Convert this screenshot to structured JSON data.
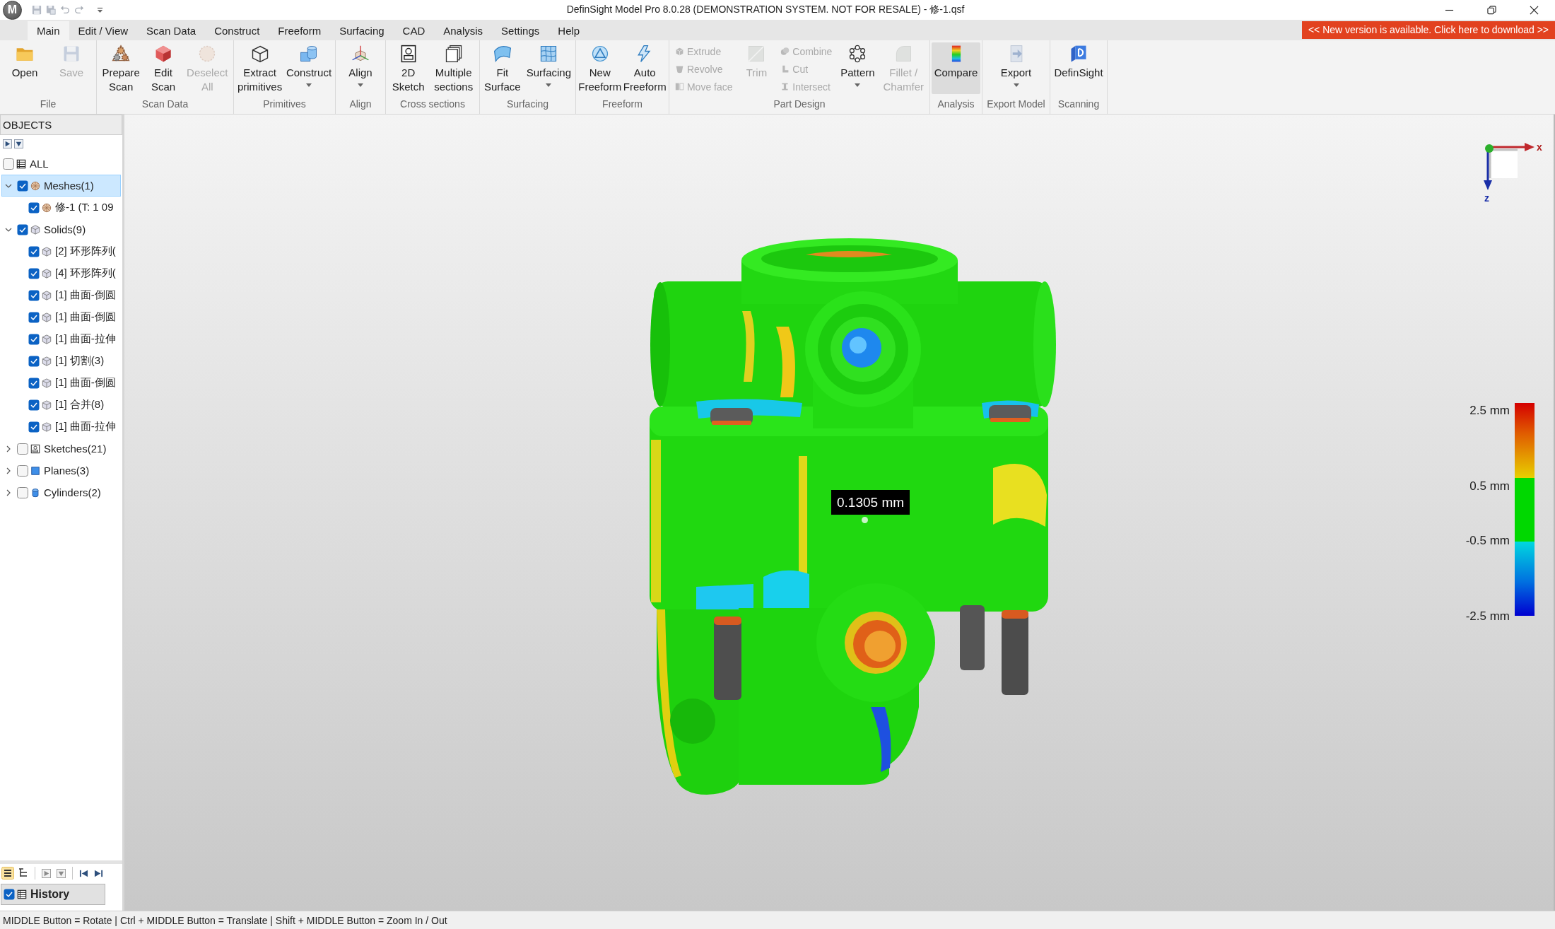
{
  "window": {
    "logo": "M",
    "title": "DefinSight Model Pro 8.0.28 (DEMONSTRATION SYSTEM. NOT FOR RESALE) - 修-1.qsf"
  },
  "menu_tabs": [
    {
      "label": "Main",
      "selected": true
    },
    {
      "label": "Edit / View",
      "selected": false
    },
    {
      "label": "Scan Data",
      "selected": false
    },
    {
      "label": "Construct",
      "selected": false
    },
    {
      "label": "Freeform",
      "selected": false
    },
    {
      "label": "Surfacing",
      "selected": false
    },
    {
      "label": "CAD",
      "selected": false
    },
    {
      "label": "Analysis",
      "selected": false
    },
    {
      "label": "Settings",
      "selected": false
    },
    {
      "label": "Help",
      "selected": false
    }
  ],
  "update_banner": {
    "label": "<< New version is available. Click here to download >>"
  },
  "ribbon": [
    {
      "label": "File",
      "items": [
        {
          "kind": "large",
          "label": "Open",
          "disabled": false,
          "pressed": false
        },
        {
          "kind": "large",
          "label": "Save",
          "disabled": true,
          "pressed": false
        }
      ]
    },
    {
      "label": "Scan Data",
      "items": [
        {
          "kind": "large",
          "label": "Prepare\nScan",
          "disabled": false,
          "pressed": false
        },
        {
          "kind": "large",
          "label": "Edit\nScan",
          "disabled": false,
          "pressed": false
        },
        {
          "kind": "large",
          "label": "Deselect\nAll",
          "disabled": true,
          "pressed": false
        }
      ]
    },
    {
      "label": "Primitives",
      "items": [
        {
          "kind": "large",
          "label": "Extract\nprimitives",
          "disabled": false,
          "pressed": false
        },
        {
          "kind": "large",
          "label": "Construct",
          "disabled": false,
          "pressed": false,
          "dropdown": true
        }
      ]
    },
    {
      "label": "Align",
      "items": [
        {
          "kind": "large",
          "label": "Align",
          "disabled": false,
          "pressed": false,
          "dropdown": true
        }
      ]
    },
    {
      "label": "Cross sections",
      "items": [
        {
          "kind": "large",
          "label": "2D\nSketch",
          "disabled": false,
          "pressed": false
        },
        {
          "kind": "large",
          "label": "Multiple\nsections",
          "disabled": false,
          "pressed": false
        }
      ]
    },
    {
      "label": "Surfacing",
      "items": [
        {
          "kind": "large",
          "label": "Fit\nSurface",
          "disabled": false,
          "pressed": false
        },
        {
          "kind": "large",
          "label": "Surfacing",
          "disabled": false,
          "pressed": false,
          "dropdown": true
        }
      ]
    },
    {
      "label": "Freeform",
      "items": [
        {
          "kind": "large",
          "label": "New\nFreeform",
          "disabled": false,
          "pressed": false
        },
        {
          "kind": "large",
          "label": "Auto\nFreeform",
          "disabled": false,
          "pressed": false
        }
      ]
    },
    {
      "label": "Part Design",
      "items": [
        {
          "kind": "stack",
          "buttons": [
            {
              "label": "Extrude",
              "disabled": true
            },
            {
              "label": "Revolve",
              "disabled": true
            },
            {
              "label": "Move face",
              "disabled": true
            }
          ]
        },
        {
          "kind": "large",
          "label": "Trim",
          "disabled": true,
          "pressed": false
        },
        {
          "kind": "stack",
          "buttons": [
            {
              "label": "Combine",
              "disabled": true
            },
            {
              "label": "Cut",
              "disabled": true
            },
            {
              "label": "Intersect",
              "disabled": true
            }
          ]
        },
        {
          "kind": "large",
          "label": "Pattern",
          "disabled": false,
          "pressed": false,
          "dropdown": true
        },
        {
          "kind": "large",
          "label": "Fillet /\nChamfer",
          "disabled": true,
          "pressed": false
        }
      ]
    },
    {
      "label": "Analysis",
      "items": [
        {
          "kind": "large",
          "label": "Compare",
          "disabled": false,
          "pressed": true
        }
      ]
    },
    {
      "label": "Export Model",
      "items": [
        {
          "kind": "large",
          "label": "Export",
          "disabled": false,
          "pressed": false,
          "dropdown": true
        }
      ]
    },
    {
      "label": "Scanning",
      "items": [
        {
          "kind": "large",
          "label": "DefinSight",
          "disabled": false,
          "pressed": false
        }
      ]
    }
  ],
  "objects_panel": {
    "title": "OBJECTS",
    "all": {
      "label": "ALL",
      "checked": false,
      "selected": false
    },
    "tree": [
      {
        "kind": "mesh",
        "label": "Meshes(1)",
        "expanded": true,
        "checked": true,
        "selected": true,
        "children": [
          {
            "kind": "mesh",
            "label": "修-1 (T: 1 09",
            "checked": true,
            "selected": false
          }
        ]
      },
      {
        "kind": "solid",
        "label": "Solids(9)",
        "expanded": true,
        "checked": true,
        "selected": false,
        "children": [
          {
            "kind": "solid",
            "label": "[2] 环形阵列(",
            "checked": true,
            "selected": false
          },
          {
            "kind": "solid",
            "label": "[4] 环形阵列(",
            "checked": true,
            "selected": false
          },
          {
            "kind": "solid",
            "label": "[1] 曲面-倒圆",
            "checked": true,
            "selected": false
          },
          {
            "kind": "solid",
            "label": "[1] 曲面-倒圆",
            "checked": true,
            "selected": false
          },
          {
            "kind": "solid",
            "label": "[1] 曲面-拉伸",
            "checked": true,
            "selected": false
          },
          {
            "kind": "solid",
            "label": "[1] 切割(3)",
            "checked": true,
            "selected": false
          },
          {
            "kind": "solid",
            "label": "[1] 曲面-倒圆",
            "checked": true,
            "selected": false
          },
          {
            "kind": "solid",
            "label": "[1] 合并(8)",
            "checked": true,
            "selected": false
          },
          {
            "kind": "solid",
            "label": "[1] 曲面-拉伸",
            "checked": true,
            "selected": false
          }
        ]
      },
      {
        "kind": "sketch",
        "label": "Sketches(21)",
        "expanded": false,
        "checked": false,
        "selected": false
      },
      {
        "kind": "plane",
        "label": "Planes(3)",
        "expanded": false,
        "checked": false,
        "selected": false
      },
      {
        "kind": "cylinder",
        "label": "Cylinders(2)",
        "expanded": false,
        "checked": false,
        "selected": false
      }
    ]
  },
  "history_panel": {
    "view_modes": [
      {
        "selected": true
      },
      {
        "selected": false
      }
    ],
    "header": {
      "label": "History",
      "checked": true
    }
  },
  "viewport": {
    "axes": [
      {
        "label": "x"
      },
      {
        "label": "z"
      }
    ],
    "measurement": "0.1305 mm",
    "color_scale": {
      "labels": [
        "2.5 mm",
        "0.5 mm",
        "-0.5 mm",
        "-2.5 mm"
      ]
    }
  },
  "status_bar": {
    "text": "MIDDLE Button = Rotate | Ctrl + MIDDLE Button = Translate | Shift + MIDDLE Button = Zoom In / Out"
  }
}
